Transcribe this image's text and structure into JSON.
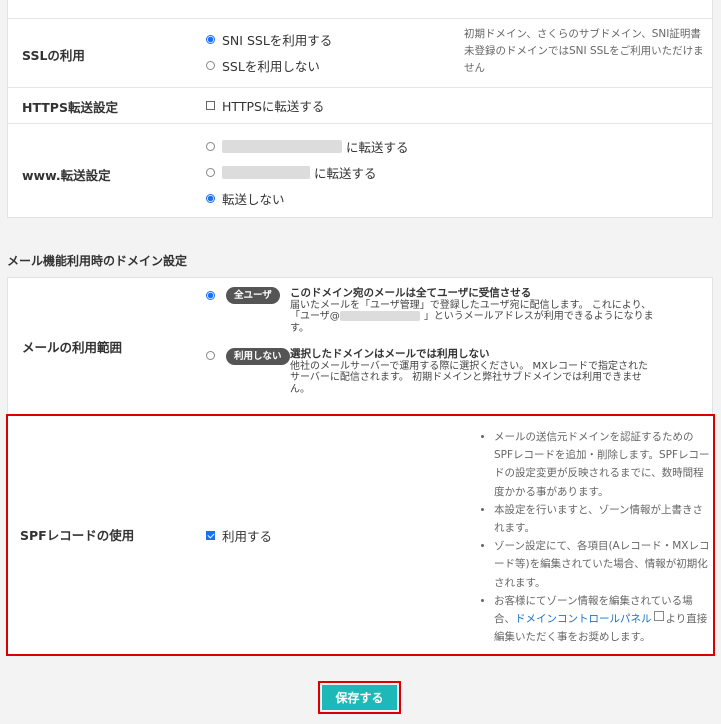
{
  "ssl": {
    "label": "SSLの利用",
    "opt_sni": "SNI SSLを利用する",
    "opt_none": "SSLを利用しない",
    "note": "初期ドメイン、さくらのサブドメイン、SNI証明書未登録のドメインではSNI SSLをご利用いただけません"
  },
  "https": {
    "label": "HTTPS転送設定",
    "opt": "HTTPSに転送する"
  },
  "www": {
    "label": "www.転送設定",
    "opt1_suffix": "に転送する",
    "opt2_suffix": "に転送する",
    "opt3": "転送しない"
  },
  "mail_section": {
    "title": "メール機能利用時のドメイン設定",
    "label": "メールの利用範囲",
    "all": {
      "badge": "全ユーザ",
      "title": "このドメイン宛のメールは全てユーザに受信させる",
      "desc1": "届いたメールを「ユーザ管理」で登録したユーザ宛に配信します。 これにより、",
      "desc2_prefix": "「ユーザ@",
      "desc2_suffix": "」というメールアドレスが利用できるようになりま",
      "desc3": "す。"
    },
    "none": {
      "badge": "利用しない",
      "title": "選択したドメインはメールでは利用しない",
      "desc1": "他社のメールサーバーで運用する際に選択ください。 MXレコードで指定された",
      "desc2": "サーバーに配信されます。 初期ドメインと弊社サブドメインでは利用できませ",
      "desc3": "ん。"
    }
  },
  "spf": {
    "label": "SPFレコードの使用",
    "opt": "利用する",
    "notes": [
      "メールの送信元ドメインを認証するためのSPFレコードを追加・削除します。SPFレコードの設定変更が反映されるまでに、数時間程度かかる事があります。",
      "本設定を行いますと、ゾーン情報が上書きされます。",
      "ゾーン設定にて、各項目(Aレコード・MXレコード等)を編集されていた場合、情報が初期化されます。"
    ],
    "note4_prefix": "お客様にてゾーン情報を編集されている場合、",
    "note4_link": "ドメインコントロールパネル",
    "note4_suffix": "より直接編集いただく事をお奨めします。"
  },
  "save_label": "保存する",
  "colors": {
    "accent": "#1fb8b8",
    "highlight": "#d80000",
    "link": "#1a73c8",
    "radio": "#1a6ff2"
  }
}
